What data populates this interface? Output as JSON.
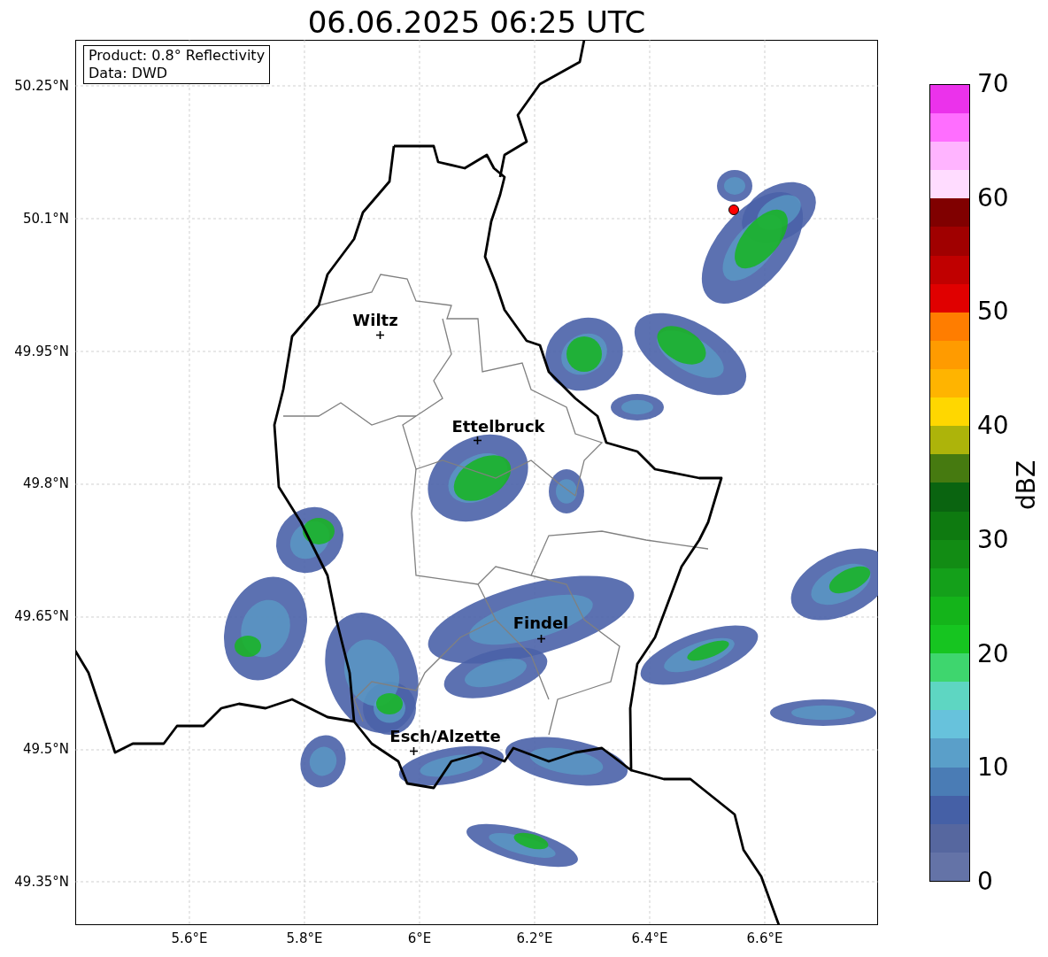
{
  "title": "06.06.2025 06:25 UTC",
  "legend": [
    "Product: 0.8° Reflectivity",
    "Data: DWD"
  ],
  "axes": {
    "x_ticks": [
      "5.6°E",
      "5.8°E",
      "6°E",
      "6.2°E",
      "6.4°E",
      "6.6°E"
    ],
    "y_ticks": [
      "50.25°N",
      "50.1°N",
      "49.95°N",
      "49.8°N",
      "49.65°N",
      "49.5°N",
      "49.35°N"
    ]
  },
  "cities": [
    {
      "name": "Wiltz"
    },
    {
      "name": "Ettelbruck"
    },
    {
      "name": "Findel"
    },
    {
      "name": "Esch/Alzette"
    }
  ],
  "colorbar": {
    "label": "dBZ",
    "ticks": [
      "70",
      "60",
      "50",
      "40",
      "30",
      "20",
      "10",
      "0"
    ],
    "segments": [
      {
        "color": "#6473a7"
      },
      {
        "color": "#56679f"
      },
      {
        "color": "#4560a6"
      },
      {
        "color": "#4a7cb5"
      },
      {
        "color": "#5a9fc9"
      },
      {
        "color": "#67c2dc"
      },
      {
        "color": "#5ed6c2"
      },
      {
        "color": "#3ed66e"
      },
      {
        "color": "#16c520"
      },
      {
        "color": "#14b41a"
      },
      {
        "color": "#14a01a"
      },
      {
        "color": "#128c14"
      },
      {
        "color": "#0e7a10"
      },
      {
        "color": "#0a6410"
      },
      {
        "color": "#467a10"
      },
      {
        "color": "#adb40a"
      },
      {
        "color": "#ffd700"
      },
      {
        "color": "#ffb400"
      },
      {
        "color": "#ff9b00"
      },
      {
        "color": "#ff7d00"
      },
      {
        "color": "#e00000"
      },
      {
        "color": "#c00000"
      },
      {
        "color": "#a00000"
      },
      {
        "color": "#800000"
      },
      {
        "color": "#ffdcff"
      },
      {
        "color": "#ffb4ff"
      },
      {
        "color": "#ff6eff"
      },
      {
        "color": "#eb32eb"
      }
    ]
  }
}
